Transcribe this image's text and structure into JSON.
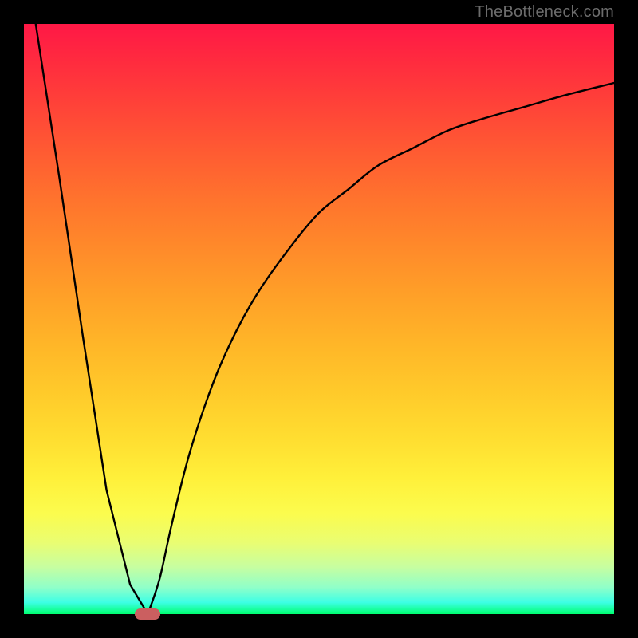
{
  "watermark": "TheBottleneck.com",
  "colors": {
    "frame": "#000000",
    "marker": "#cb5f60",
    "curve": "#000000"
  },
  "chart_data": {
    "type": "line",
    "title": "",
    "xlabel": "",
    "ylabel": "",
    "xlim": [
      0,
      100
    ],
    "ylim": [
      0,
      100
    ],
    "grid": false,
    "legend": false,
    "marker": {
      "x": 21,
      "y": 0
    },
    "series": [
      {
        "name": "left-branch",
        "x": [
          2,
          6,
          10,
          14,
          18,
          21
        ],
        "y": [
          100,
          74,
          47,
          21,
          5,
          0
        ]
      },
      {
        "name": "right-branch",
        "x": [
          21,
          23,
          25,
          28,
          32,
          36,
          40,
          45,
          50,
          55,
          60,
          66,
          72,
          78,
          85,
          92,
          100
        ],
        "y": [
          0,
          6,
          15,
          27,
          39,
          48,
          55,
          62,
          68,
          72,
          76,
          79,
          82,
          84,
          86,
          88,
          90
        ]
      }
    ],
    "background_gradient": {
      "top": "#ff1846",
      "bottom": "#00ff72",
      "description": "vertical red-to-green gradient representing bottleneck severity"
    }
  }
}
